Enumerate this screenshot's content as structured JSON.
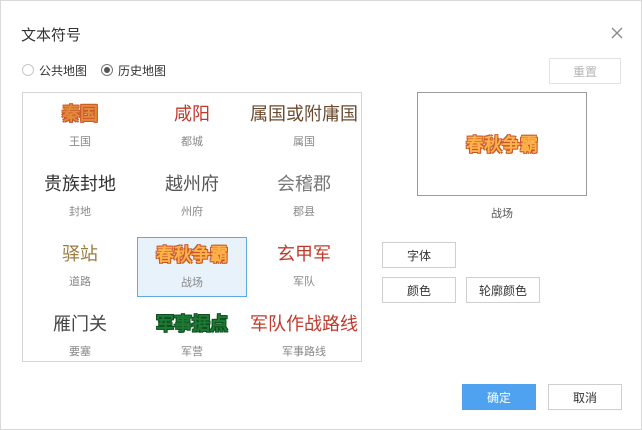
{
  "dialog": {
    "title": "文本符号",
    "close_icon": "close-icon"
  },
  "map_type": {
    "options": [
      {
        "label": "公共地图",
        "checked": false
      },
      {
        "label": "历史地图",
        "checked": true
      }
    ],
    "reset_label": "重置"
  },
  "symbols": [
    {
      "text": "秦国",
      "label": "王国",
      "color": "#e28a3a",
      "outline": "#c9552a",
      "bold": true
    },
    {
      "text": "咸阳",
      "label": "都城",
      "color": "#c0392b",
      "outline": "",
      "bold": false
    },
    {
      "text": "属国或附庸国",
      "label": "属国",
      "color": "#6b4b2f",
      "outline": "",
      "bold": false
    },
    {
      "text": "贵族封地",
      "label": "封地",
      "color": "#333333",
      "outline": "",
      "bold": false
    },
    {
      "text": "越州府",
      "label": "州府",
      "color": "#555555",
      "outline": "",
      "bold": false
    },
    {
      "text": "会稽郡",
      "label": "郡县",
      "color": "#777777",
      "outline": "",
      "bold": false
    },
    {
      "text": "驿站",
      "label": "道路",
      "color": "#9a7d42",
      "outline": "",
      "bold": false
    },
    {
      "text": "春秋争霸",
      "label": "战场",
      "color": "#ffb24a",
      "outline": "#c9552a",
      "bold": true
    },
    {
      "text": "玄甲军",
      "label": "军队",
      "color": "#c0392b",
      "outline": "",
      "bold": false
    },
    {
      "text": "雁门关",
      "label": "要塞",
      "color": "#444444",
      "outline": "",
      "bold": false
    },
    {
      "text": "军事据点",
      "label": "军营",
      "color": "#1d7a34",
      "outline": "#0e4d1e",
      "bold": true
    },
    {
      "text": "军队作战路线",
      "label": "军事路线",
      "color": "#c0392b",
      "outline": "",
      "bold": false
    }
  ],
  "selected_index": 7,
  "preview": {
    "text": "春秋争霸",
    "caption": "战场"
  },
  "style_buttons": {
    "font_label": "字体",
    "color_label": "颜色",
    "outline_color_label": "轮廓颜色"
  },
  "footer": {
    "ok_label": "确定",
    "cancel_label": "取消"
  }
}
